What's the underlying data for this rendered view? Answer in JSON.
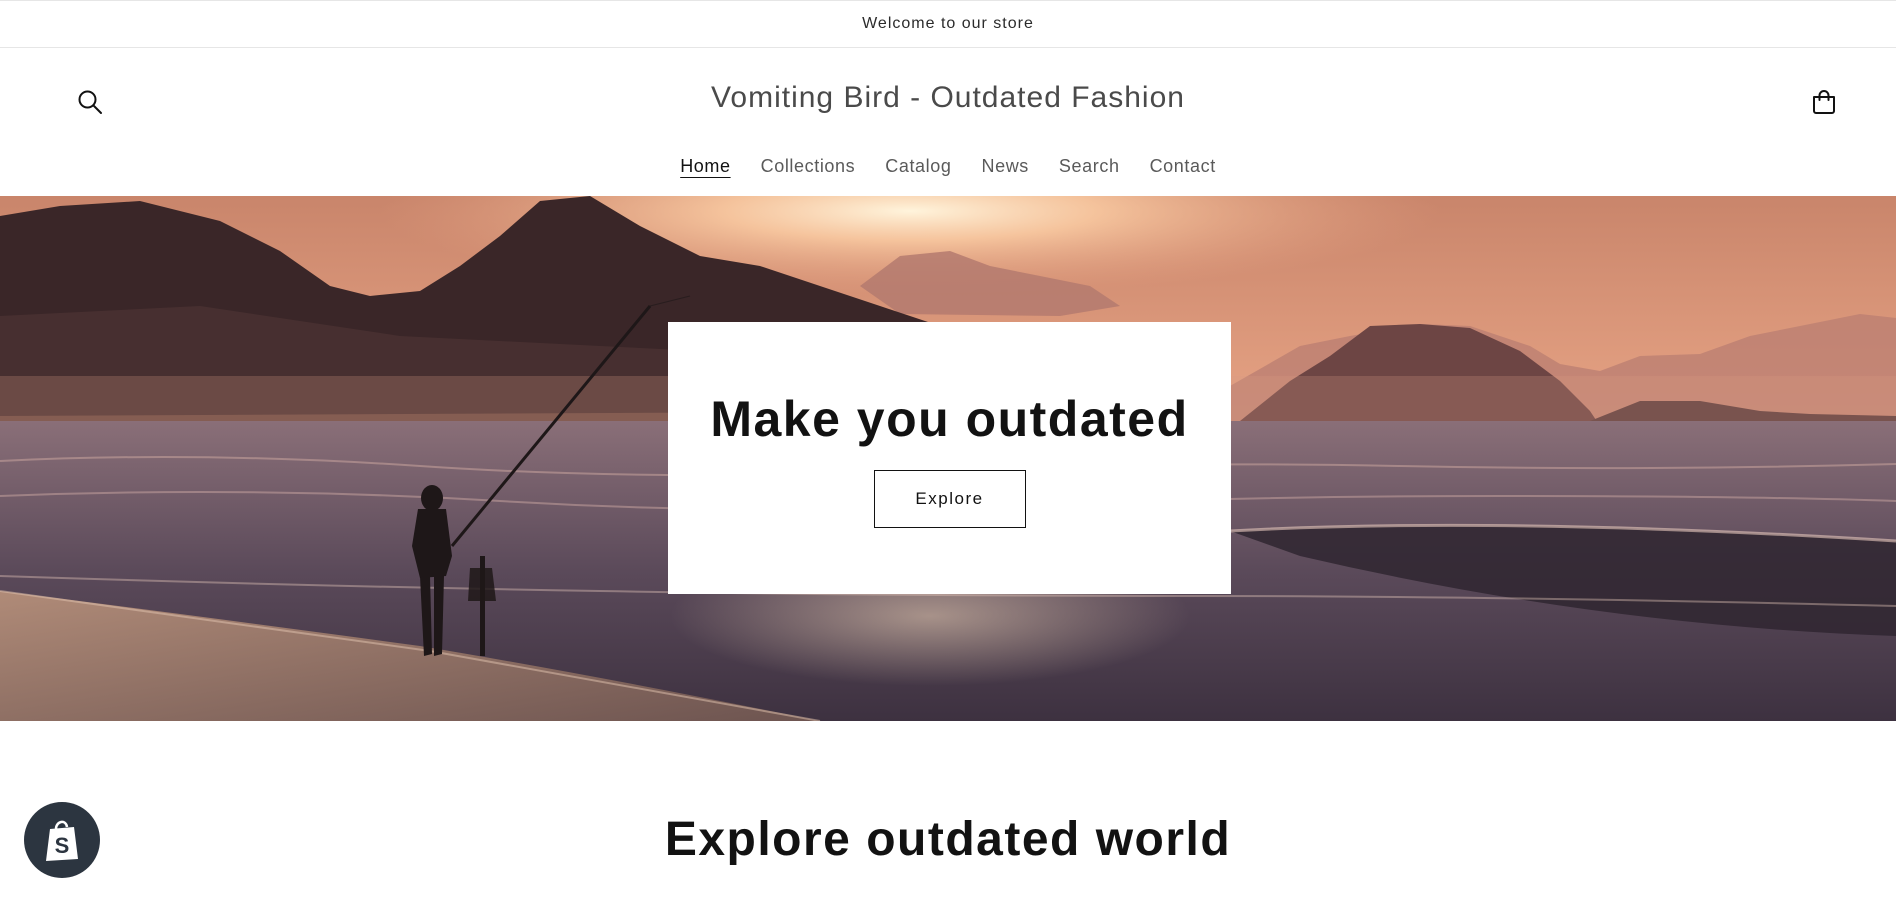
{
  "announcement": {
    "text": "Welcome to our store"
  },
  "header": {
    "title": "Vomiting Bird - Outdated Fashion",
    "search_icon": "search-icon",
    "cart_icon": "cart-icon"
  },
  "nav": {
    "items": [
      {
        "label": "Home",
        "active": true
      },
      {
        "label": "Collections",
        "active": false
      },
      {
        "label": "Catalog",
        "active": false
      },
      {
        "label": "News",
        "active": false
      },
      {
        "label": "Search",
        "active": false
      },
      {
        "label": "Contact",
        "active": false
      }
    ]
  },
  "hero": {
    "heading": "Make you outdated",
    "button_label": "Explore",
    "image_subject": "fisherman-on-beach-at-sunset"
  },
  "section": {
    "heading": "Explore outdated world"
  },
  "badge": {
    "icon": "shopify-bag-icon"
  },
  "colors": {
    "text": "#121212",
    "muted": "#5a5a5a",
    "badge_bg": "#2c3540"
  }
}
